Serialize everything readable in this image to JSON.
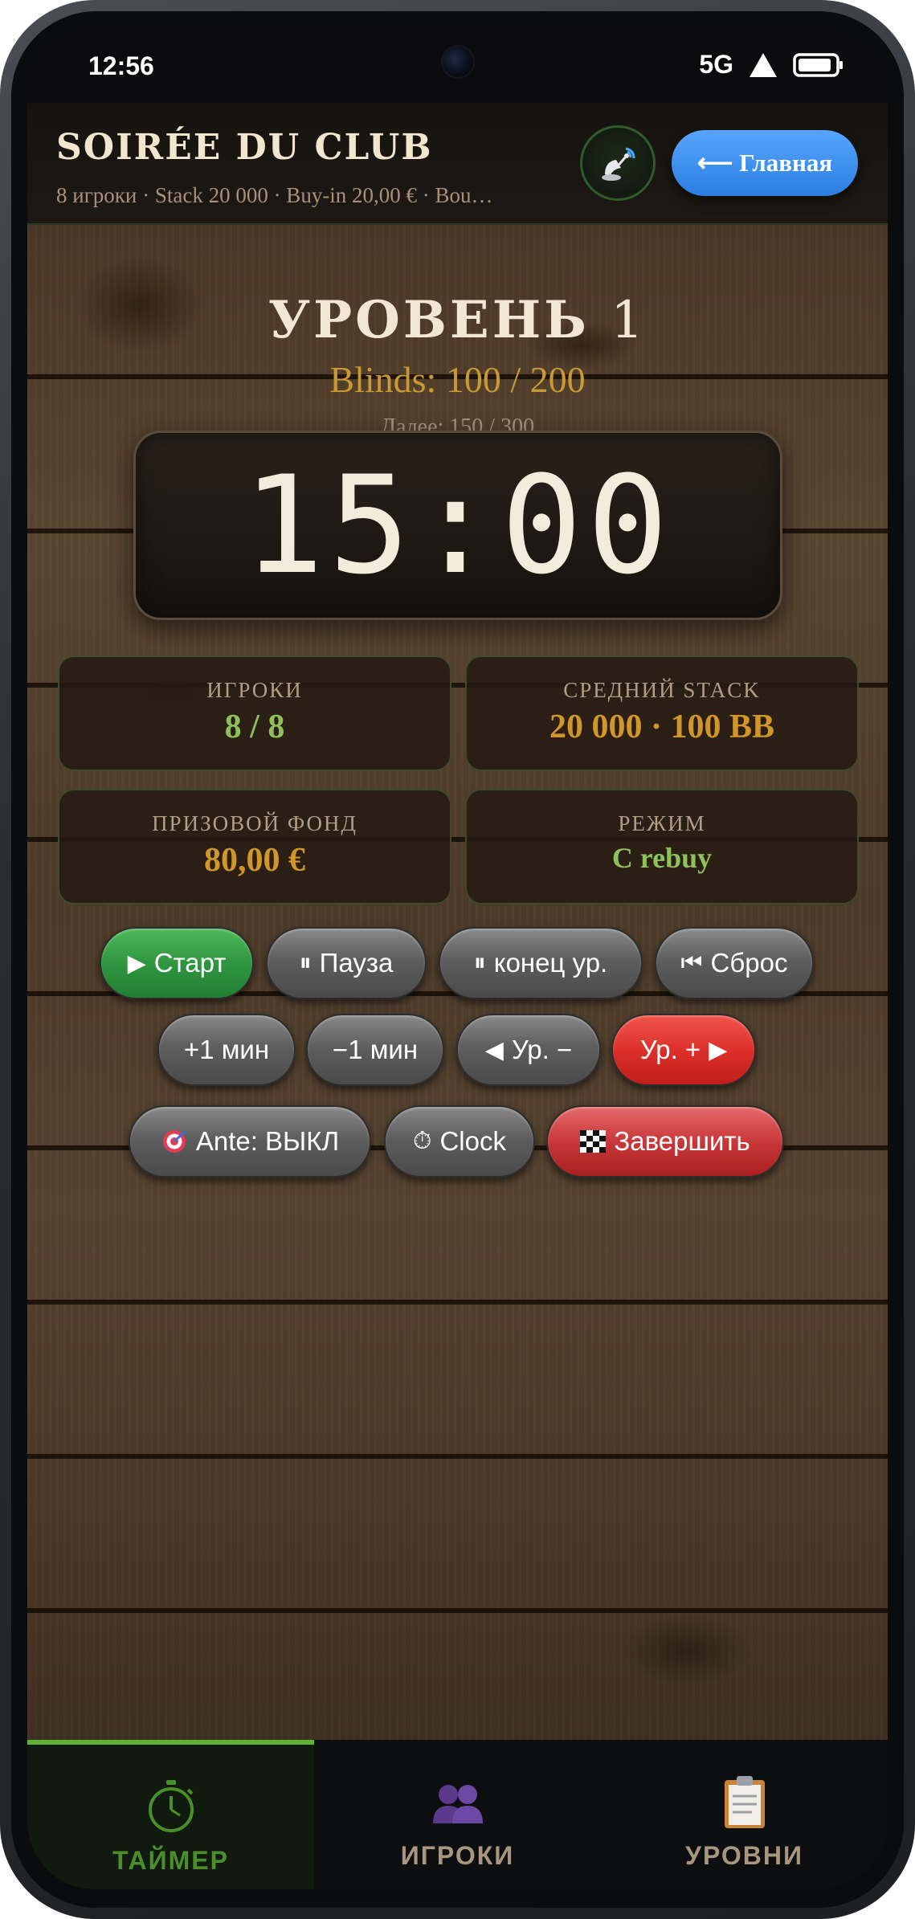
{
  "status_bar": {
    "time": "12:56",
    "network": "5G"
  },
  "header": {
    "title": "Soirée du club",
    "subtitle": "8 игроки · Stack 20 000 · Buy-in 20,00 € · Bou…",
    "home_button": "⟵ Главная",
    "cast_icon": "cast-icon"
  },
  "level": {
    "label": "УРОВЕНЬ",
    "number": "1",
    "blinds": "Blinds: 100 / 200",
    "next": "Далее: 150 / 300"
  },
  "timer": {
    "display": "15:00"
  },
  "stats": [
    {
      "label": "ИГРОКИ",
      "value": "8 / 8"
    },
    {
      "label": "СРЕДНИЙ STACK",
      "value": "20 000 · 100 BB"
    },
    {
      "label": "ПРИЗОВОЙ ФОНД",
      "value": "80,00 €"
    },
    {
      "label": "РЕЖИМ",
      "value": "С rebuy"
    }
  ],
  "controls": {
    "start": "Старт",
    "pause": "Пауза",
    "end_level": "конец ур.",
    "reset": "Сброс",
    "plus_min": "+1 мин",
    "minus_min": "−1 мин",
    "level_down": "Ур. −",
    "level_up": "Ур. +",
    "ante": "Ante: ВЫКЛ",
    "clock": "Clock",
    "finish": "Завершить"
  },
  "bottom_nav": [
    {
      "label": "ТАЙМЕР",
      "icon": "stopwatch-icon",
      "active": true
    },
    {
      "label": "ИГРОКИ",
      "icon": "players-icon",
      "active": false
    },
    {
      "label": "УРОВНИ",
      "icon": "clipboard-icon",
      "active": false
    }
  ],
  "colors": {
    "accent_green": "#5fb237",
    "gold": "#c99a34",
    "home_blue": "#3d8df0",
    "danger_red": "#db2d28"
  }
}
